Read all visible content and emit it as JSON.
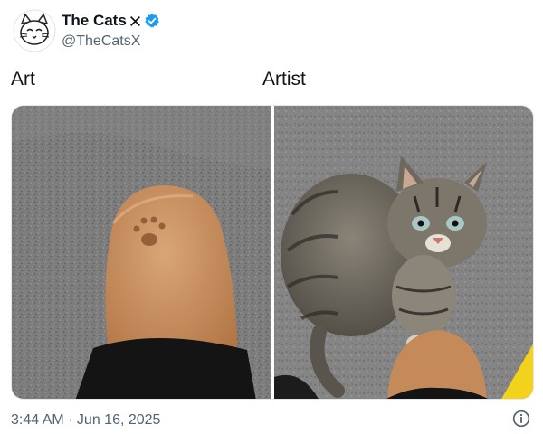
{
  "tweet": {
    "author": {
      "display_name": "The Cats",
      "handle": "@TheCatsX",
      "verified": true,
      "avatar_icon": "cat-avatar"
    },
    "labels": {
      "left": "Art",
      "right": "Artist"
    },
    "timestamp": "3:44 AM · Jun 16, 2025",
    "images": [
      {
        "icon": "paw-print-on-boot-photo"
      },
      {
        "icon": "tabby-cat-photo"
      }
    ],
    "icons": {
      "x_logo": "x-logo-icon",
      "verified_badge": "verified-badge-icon",
      "info": "info-icon"
    },
    "colors": {
      "text": "#0f1419",
      "secondary": "#536471",
      "verified": "#1d9bf0",
      "boot": "#c88e5b",
      "pavement": "#7a7a7a"
    }
  }
}
